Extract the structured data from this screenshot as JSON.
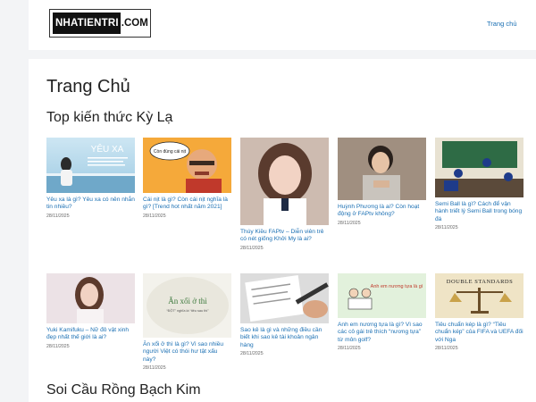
{
  "site": {
    "logo_dark": "NHATIENTRI",
    "logo_light": ".COM",
    "nav_home": "Trang chủ"
  },
  "page_title": "Trang Chủ",
  "sections": [
    {
      "title": "Top kiến thức Kỳ Lạ",
      "row1": [
        {
          "title": "Yêu xa là gì? Yêu xa có nên nhắn tin nhiều?",
          "date": "28/11/2025",
          "thumb_caption": "YÊU XA"
        },
        {
          "title": "Cái nịt là gì? Còn cái nịt nghĩa là gì? [Trend hot nhất năm 2021]",
          "date": "28/11/2025",
          "thumb_caption": "Còn đúng cái nịt"
        },
        {
          "title": "Thúy Kiều FAPtv – Diễn viên trẻ có nét giống Khởi My là ai?",
          "date": "28/11/2025",
          "thumb_caption": ""
        },
        {
          "title": "Huỳnh Phương là ai? Còn hoạt động ở FAPtv không?",
          "date": "28/11/2025",
          "thumb_caption": ""
        },
        {
          "title": "Semi Ball là gì? Cách để vận hành triết lý Semi Ball trong bóng đá",
          "date": "28/11/2025",
          "thumb_caption": ""
        }
      ],
      "row2": [
        {
          "title": "Yuki Kamifuku – Nữ đô vật xinh đẹp nhất thế giới là ai?",
          "date": "28/11/2025",
          "thumb_caption": ""
        },
        {
          "title": "Ăn xổi ở thì là gì? Vì sao nhiều người Việt có thói hư tật xấu này?",
          "date": "28/11/2025",
          "thumb_caption": "Ăn xổi ở thì",
          "thumb_sub": "“ĐỘT” nghĩa là “tiêu sau thì”"
        },
        {
          "title": "Sao kê là gì và những điều cần biết khi sao kê tài khoản ngân hàng",
          "date": "28/11/2025",
          "thumb_caption": ""
        },
        {
          "title": "Anh em nương tựa là gì? Vì sao các cô gái trẻ thích “nương tựa” từ môn golf?",
          "date": "28/11/2025",
          "thumb_caption": "Anh em nương tựa là gì"
        },
        {
          "title": "Tiêu chuẩn kép là gì? “Tiêu chuẩn kép” của FIFA và UEFA đối với Nga",
          "date": "28/11/2025",
          "thumb_caption": "DOUBLE STANDARDS"
        }
      ]
    },
    {
      "title": "Soi Cầu Rồng Bạch Kim"
    }
  ]
}
